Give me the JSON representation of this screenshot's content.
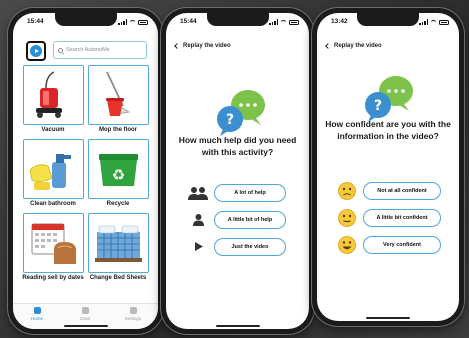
{
  "phone_home": {
    "status": {
      "time": "15:44"
    },
    "search": {
      "placeholder": "Search AutonoMe"
    },
    "tiles": [
      {
        "label": "Vacuum"
      },
      {
        "label": "Mop the floor"
      },
      {
        "label": "Clean bathroom"
      },
      {
        "label": "Recycle"
      },
      {
        "label": "Reading sell by dates"
      },
      {
        "label": "Change Bed Sheets"
      }
    ],
    "tabs": [
      {
        "label": "Home"
      },
      {
        "label": "Scan"
      },
      {
        "label": "Settings"
      }
    ]
  },
  "phone_help": {
    "status": {
      "time": "15:44"
    },
    "back_label": "Replay the video",
    "question": "How much help did you need with this activity?",
    "options": [
      {
        "label": "A lot of help",
        "icon": "two-people-icon"
      },
      {
        "label": "A little bit of help",
        "icon": "person-icon"
      },
      {
        "label": "Just the video",
        "icon": "play-icon"
      }
    ]
  },
  "phone_confidence": {
    "status": {
      "time": "13:42"
    },
    "back_label": "Replay the video",
    "question": "How confident are you with the information in the video?",
    "options": [
      {
        "label": "Not at all confident",
        "icon": "worried-face-icon"
      },
      {
        "label": "A little bit confident",
        "icon": "neutral-face-icon"
      },
      {
        "label": "Very confident",
        "icon": "happy-face-icon"
      }
    ]
  },
  "colors": {
    "accent": "#2a8fd6",
    "tile_border": "#53a8d9",
    "bubble_green": "#7cc24b",
    "bubble_blue": "#3b8fd0"
  }
}
